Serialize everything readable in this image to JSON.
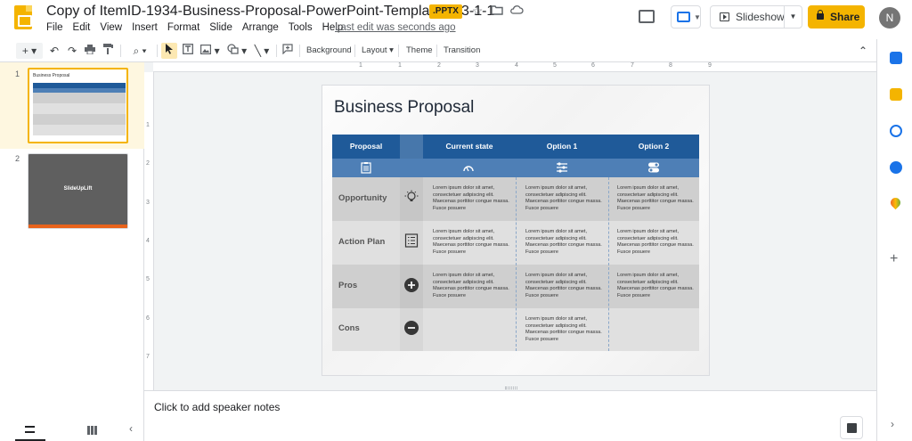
{
  "doc": {
    "title": "Copy of ItemID-1934-Business-Proposal-PowerPoint-Template-4x3-1-1",
    "badge": ".PPTX",
    "last_edit": "Last edit was seconds ago"
  },
  "menu": [
    "File",
    "Edit",
    "View",
    "Insert",
    "Format",
    "Slide",
    "Arrange",
    "Tools",
    "Help"
  ],
  "header_buttons": {
    "slideshow": "Slideshow",
    "share": "Share",
    "avatar_initial": "N"
  },
  "toolbar": {
    "background": "Background",
    "layout": "Layout",
    "theme": "Theme",
    "transition": "Transition"
  },
  "filmstrip": {
    "slides": [
      {
        "number": "1",
        "mini_title": "Business Proposal"
      },
      {
        "number": "2",
        "label": "SlideUpLift"
      }
    ]
  },
  "rulers": {
    "h": [
      "1",
      "1",
      "2",
      "3",
      "4",
      "5",
      "6",
      "7",
      "8",
      "9"
    ],
    "v": [
      "1",
      "2",
      "3",
      "4",
      "5",
      "6",
      "7"
    ]
  },
  "slide": {
    "title": "Business Proposal",
    "table": {
      "headers": [
        "Proposal",
        "Current state",
        "Option 1",
        "Option 2"
      ],
      "icons": [
        "clipboard-icon",
        "speedometer-icon",
        "sliders-icon",
        "toggles-icon"
      ],
      "rows": [
        {
          "label": "Opportunity",
          "icon": "lightbulb-icon",
          "cells": [
            "Lorem ipsum dolor sit amet, consectetuer adipiscing elit. Maecenas porttitor congue massa. Fusce posuere",
            "Lorem ipsum dolor sit amet, consectetuer adipiscing elit. Maecenas porttitor congue massa. Fusce posuere",
            "Lorem ipsum dolor sit amet, consectetuer adipiscing elit. Maecenas porttitor congue massa. Fusce posuere"
          ]
        },
        {
          "label": "Action Plan",
          "icon": "list-icon",
          "cells": [
            "Lorem ipsum dolor sit amet, consectetuer adipiscing elit. Maecenas porttitor congue massa. Fusce posuere",
            "Lorem ipsum dolor sit amet, consectetuer adipiscing elit. Maecenas porttitor congue massa. Fusce posuere",
            "Lorem ipsum dolor sit amet, consectetuer adipiscing elit. Maecenas porttitor congue massa. Fusce posuere"
          ]
        },
        {
          "label": "Pros",
          "icon": "plus-circle-icon",
          "cells": [
            "Lorem ipsum dolor sit amet, consectetuer adipiscing elit. Maecenas porttitor congue massa. Fusce posuere",
            "Lorem ipsum dolor sit amet, consectetuer adipiscing elit. Maecenas porttitor congue massa. Fusce posuere",
            "Lorem ipsum dolor sit amet, consectetuer adipiscing elit. Maecenas porttitor congue massa. Fusce posuere"
          ]
        },
        {
          "label": "Cons",
          "icon": "minus-circle-icon",
          "cells": [
            "",
            "Lorem ipsum dolor sit amet, consectetuer adipiscing elit. Maecenas porttitor congue massa. Fusce posuere",
            ""
          ]
        }
      ]
    }
  },
  "notes": {
    "placeholder": "Click to add speaker notes"
  },
  "colors": {
    "accent": "#f4b400",
    "table_header": "#1f5a99",
    "table_icon_row": "#4e7fb6",
    "row_dark": "#cfcfcf",
    "row_light": "#e0e0e0",
    "thumb2_bg": "#5f5f5f",
    "thumb2_bar": "#e8631c"
  }
}
